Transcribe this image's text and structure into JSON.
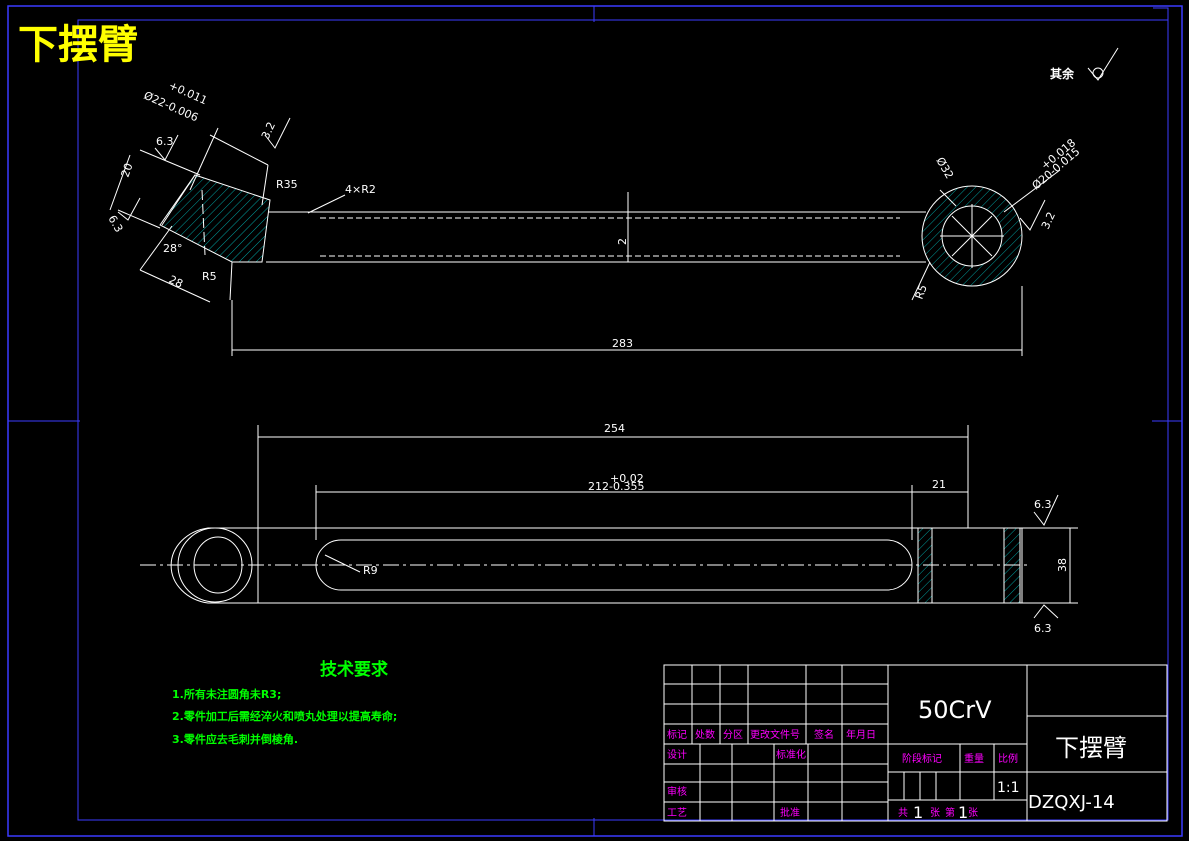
{
  "title": "下摆臂",
  "surface_note": {
    "label": "其余"
  },
  "top_view": {
    "dia_left_main": "Ø22-0.006",
    "dia_left_tol": "+0.011",
    "rough_a": "3.2",
    "rough_b": "6.3",
    "rough_c": "6.3",
    "dim_20": "20",
    "dim_28": "28",
    "angle_28": "28°",
    "r35": "R35",
    "r5_left": "R5",
    "fillets": "4×R2",
    "dim_2": "2",
    "dia_32": "Ø32",
    "dia_right_main": "Ø20-0.015",
    "dia_right_tol": "+0.018",
    "rough_right": "3.2",
    "r5_right": "R5",
    "length_283": "283"
  },
  "bottom_view": {
    "length_254": "254",
    "slot_main": "212-0.355",
    "slot_tol": "+0.02",
    "dim_21": "21",
    "rough_top": "6.3",
    "rough_bottom": "6.3",
    "height_38": "38",
    "r9": "R9"
  },
  "tech": {
    "heading": "技术要求",
    "items": [
      "1.所有未注圆角未R3;",
      "2.零件加工后需经淬火和喷丸处理以提高寿命;",
      "3.零件应去毛刺并倒棱角."
    ]
  },
  "title_block": {
    "material": "50CrV",
    "part_name": "下摆臂",
    "drawing_no": "DZQXJ-14",
    "scale": "1:1",
    "h_mark": "标记",
    "h_count": "处数",
    "h_zone": "分区",
    "h_change": "更改文件号",
    "h_sign": "签名",
    "h_date": "年月日",
    "design": "设计",
    "standard": "标准化",
    "review": "审核",
    "process": "工艺",
    "approve": "批准",
    "stage": "阶段标记",
    "weight": "重量",
    "ratio": "比例",
    "total": "共",
    "total_n": "1",
    "sheet_unit": "张",
    "page": "第",
    "page_n": "1",
    "page_unit": "张"
  },
  "colors": {
    "background": "#000000",
    "outline": "#ffffff",
    "frame": "#3b3bff",
    "hatch": "#00a0a0",
    "tech_text": "#00ff00",
    "label_text": "#ff00ff",
    "title_text": "#ffff00"
  }
}
